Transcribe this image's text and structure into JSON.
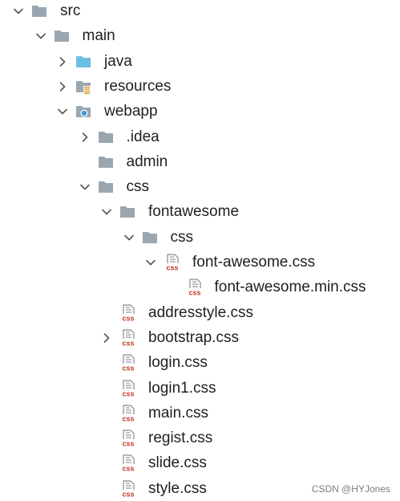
{
  "tree": {
    "items": [
      {
        "label": "src",
        "level": 0,
        "expanded": true,
        "icon": "folder-icon"
      },
      {
        "label": "main",
        "level": 1,
        "expanded": true,
        "icon": "folder-icon"
      },
      {
        "label": "java",
        "level": 2,
        "expanded": false,
        "icon": "source-folder-icon"
      },
      {
        "label": "resources",
        "level": 2,
        "expanded": false,
        "icon": "resources-folder-icon"
      },
      {
        "label": "webapp",
        "level": 2,
        "expanded": true,
        "icon": "web-folder-icon"
      },
      {
        "label": ".idea",
        "level": 3,
        "expanded": false,
        "icon": "folder-icon"
      },
      {
        "label": "admin",
        "level": 3,
        "expanded": null,
        "icon": "folder-icon"
      },
      {
        "label": "css",
        "level": 3,
        "expanded": true,
        "icon": "folder-icon"
      },
      {
        "label": "fontawesome",
        "level": 4,
        "expanded": true,
        "icon": "folder-icon"
      },
      {
        "label": "css",
        "level": 5,
        "expanded": true,
        "icon": "folder-icon"
      },
      {
        "label": "font-awesome.css",
        "level": 6,
        "expanded": true,
        "icon": "css-file-icon"
      },
      {
        "label": "font-awesome.min.css",
        "level": 7,
        "expanded": null,
        "icon": "css-file-icon"
      },
      {
        "label": "addresstyle.css",
        "level": 4,
        "expanded": null,
        "icon": "css-file-icon"
      },
      {
        "label": "bootstrap.css",
        "level": 4,
        "expanded": false,
        "icon": "css-file-icon"
      },
      {
        "label": "login.css",
        "level": 4,
        "expanded": null,
        "icon": "css-file-icon"
      },
      {
        "label": "login1.css",
        "level": 4,
        "expanded": null,
        "icon": "css-file-icon"
      },
      {
        "label": "main.css",
        "level": 4,
        "expanded": null,
        "icon": "css-file-icon"
      },
      {
        "label": "regist.css",
        "level": 4,
        "expanded": null,
        "icon": "css-file-icon"
      },
      {
        "label": "slide.css",
        "level": 4,
        "expanded": null,
        "icon": "css-file-icon"
      },
      {
        "label": "style.css",
        "level": 4,
        "expanded": null,
        "icon": "css-file-icon"
      }
    ]
  },
  "watermark": "CSDN @HYJones",
  "colors": {
    "folder": "#9aa7b0",
    "source_folder": "#6cbfe0",
    "css_badge": "#c0392b",
    "chevron": "#555555"
  }
}
